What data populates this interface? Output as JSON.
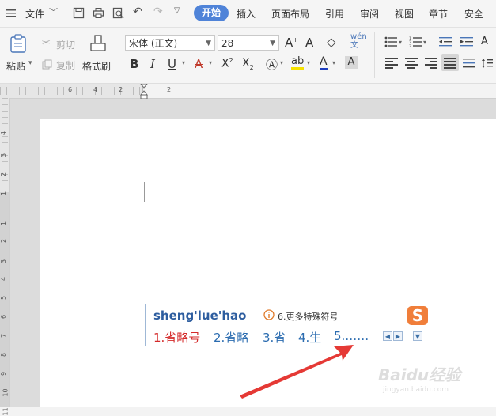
{
  "menubar": {
    "file_label": "文件",
    "tabs": [
      "开始",
      "插入",
      "页面布局",
      "引用",
      "审阅",
      "视图",
      "章节",
      "安全"
    ]
  },
  "ribbon": {
    "paste_label": "粘贴",
    "cut_label": "剪切",
    "copy_label": "复制",
    "format_painter_label": "格式刷",
    "font_name": "宋体 (正文)",
    "font_size": "28"
  },
  "ruler": {
    "top_ticks": [
      "6",
      "4",
      "2",
      "2"
    ],
    "left_ticks": [
      "4",
      "3",
      "2",
      "1",
      "1",
      "2",
      "3",
      "4",
      "5",
      "6",
      "7",
      "8",
      "9",
      "10",
      "11"
    ]
  },
  "ime": {
    "input_text": "sheng'lue'hao",
    "hint_text": "6.更多特殊符号",
    "candidates": [
      "1.省略号",
      "2.省略",
      "3.省",
      "4.生",
      "5.……"
    ]
  },
  "watermark": {
    "brand": "Baidu经验",
    "url": "jingyan.baidu.com"
  },
  "colors": {
    "accent": "#4f83d8",
    "first_candidate": "#d42a2a",
    "candidate": "#2b6cb0",
    "arrow": "#e53935"
  }
}
